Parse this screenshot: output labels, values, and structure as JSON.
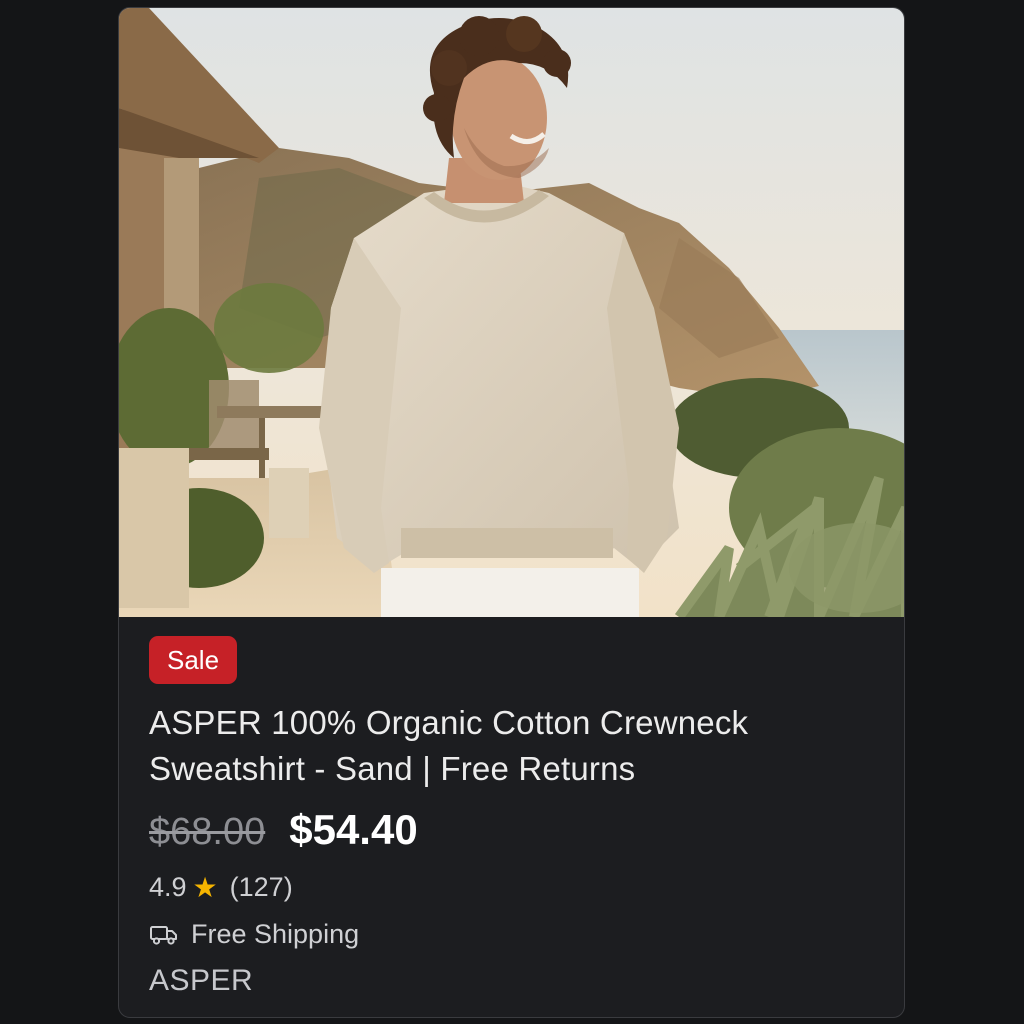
{
  "product": {
    "image_alt": "Man wearing sand crewneck sweatshirt on a coastal terrace",
    "badge": "Sale",
    "title_line1": "ASPER 100% Organic Cotton Crewneck",
    "title_line2": "Sweatshirt - Sand | Free Returns",
    "original_price": "$68.00",
    "sale_price": "$54.40",
    "rating": "4.9",
    "review_count": "(127)",
    "shipping": "Free Shipping",
    "brand": "ASPER"
  },
  "colors": {
    "badge": "#c62127",
    "star": "#f5b400",
    "background": "#141517",
    "card": "#1c1d20"
  },
  "icons": {
    "rating": "star-icon",
    "shipping": "truck-icon"
  }
}
